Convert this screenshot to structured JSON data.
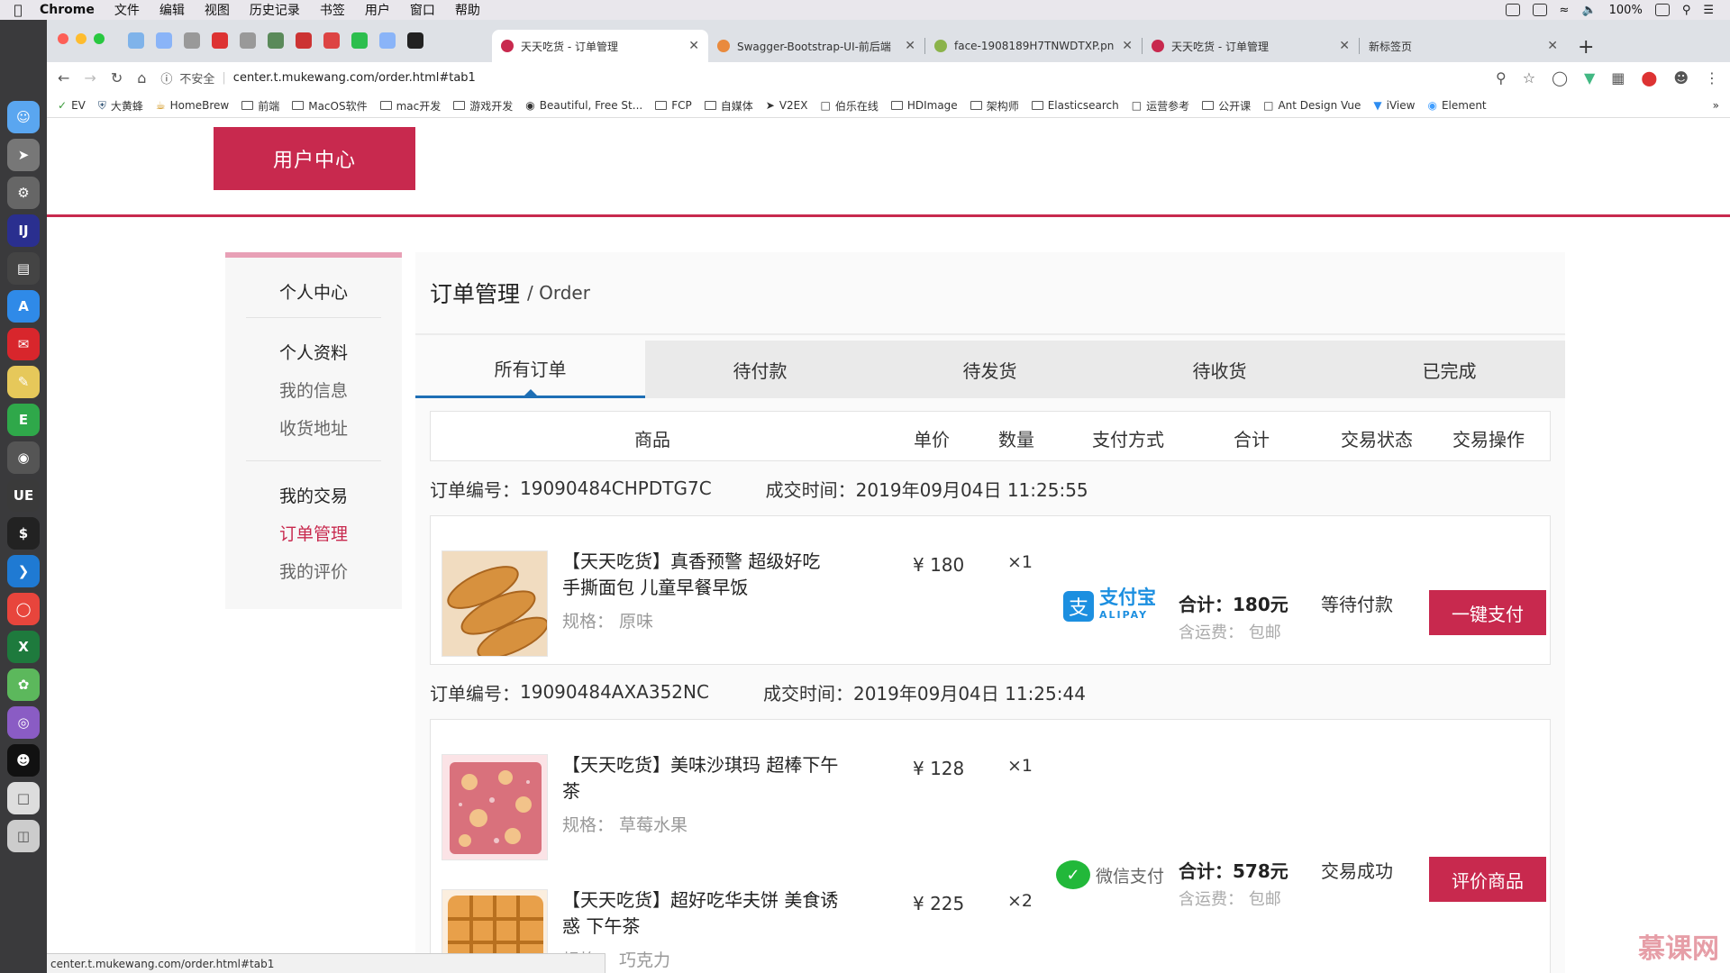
{
  "menubar": {
    "app": "Chrome",
    "items": [
      "文件",
      "编辑",
      "视图",
      "历史记录",
      "书签",
      "用户",
      "窗口",
      "帮助"
    ],
    "battery": "100%"
  },
  "browser": {
    "tabs": [
      {
        "title": "天天吃货 - 订单管理",
        "favicon_color": "#c8294e",
        "active": true
      },
      {
        "title": "Swagger-Bootstrap-UI-前后端",
        "favicon_color": "#e98a3d",
        "active": false
      },
      {
        "title": "face-1908189H7TNWDTXP.pn",
        "favicon_color": "#8bb34a",
        "active": false
      },
      {
        "title": "天天吃货 - 订单管理",
        "favicon_color": "#c8294e",
        "active": false
      },
      {
        "title": "新标签页",
        "favicon_color": "#dee1e6",
        "active": false
      }
    ],
    "insecure_label": "不安全",
    "url": "center.t.mukewang.com/order.html#tab1",
    "bookmarks": [
      "EV",
      "大黄蜂",
      "HomeBrew",
      "前端",
      "MacOS软件",
      "mac开发",
      "游戏开发",
      "Beautiful, Free St...",
      "FCP",
      "自媒体",
      "V2EX",
      "伯乐在线",
      "HDImage",
      "架构师",
      "Elasticsearch",
      "运营参考",
      "公开课",
      "Ant Design Vue",
      "iView",
      "Element"
    ],
    "status_url": "center.t.mukewang.com/order.html#tab1"
  },
  "header": {
    "brand": "用户中心"
  },
  "sidebar": {
    "title": "个人中心",
    "group1": "个人资料",
    "group1_links": [
      "我的信息",
      "收货地址"
    ],
    "group2": "我的交易",
    "group2_links": [
      "订单管理",
      "我的评价"
    ],
    "active_link": "订单管理"
  },
  "main": {
    "title": "订单管理",
    "subtitle": "/ Order",
    "tabs": [
      "所有订单",
      "待付款",
      "待发货",
      "待收货",
      "已完成"
    ],
    "active_tab": "所有订单",
    "columns": [
      "商品",
      "单价",
      "数量",
      "支付方式",
      "合计",
      "交易状态",
      "交易操作"
    ]
  },
  "orders": [
    {
      "number_label": "订单编号：",
      "number": "19090484CHPDTG7C",
      "time_label": "成交时间：",
      "time": "2019年09月04日 11:25:55",
      "items": [
        {
          "name": "【天天吃货】真香预警 超级好吃 手撕面包 儿童早餐早饭",
          "spec": "规格：  原味",
          "price": "¥ 180",
          "qty": "×1",
          "image": "bread"
        }
      ],
      "payment": "支付宝",
      "payment_en": "ALIPAY",
      "total": "合计：180元",
      "shipping": "含运费：  包邮",
      "status": "等待付款",
      "action": "一键支付"
    },
    {
      "number_label": "订单编号：",
      "number": "19090484AXA352NC",
      "time_label": "成交时间：",
      "time": "2019年09月04日 11:25:44",
      "items": [
        {
          "name": "【天天吃货】美味沙琪玛 超棒下午茶",
          "spec": "规格：  草莓水果",
          "price": "¥ 128",
          "qty": "×1",
          "image": "sachima"
        },
        {
          "name": "【天天吃货】超好吃华夫饼 美食诱惑 下午茶",
          "spec": "规格：  巧克力",
          "price": "¥ 225",
          "qty": "×2",
          "image": "waffle"
        }
      ],
      "payment": "微信支付",
      "total": "合计：578元",
      "shipping": "含运费：  包邮",
      "status": "交易成功",
      "action": "评价商品"
    }
  ],
  "watermark": "慕课网",
  "colors": {
    "brand": "#c8294e",
    "tab_indicator": "#1e6fb5",
    "alipay": "#1c8fe0",
    "wechat": "#22b83a"
  }
}
